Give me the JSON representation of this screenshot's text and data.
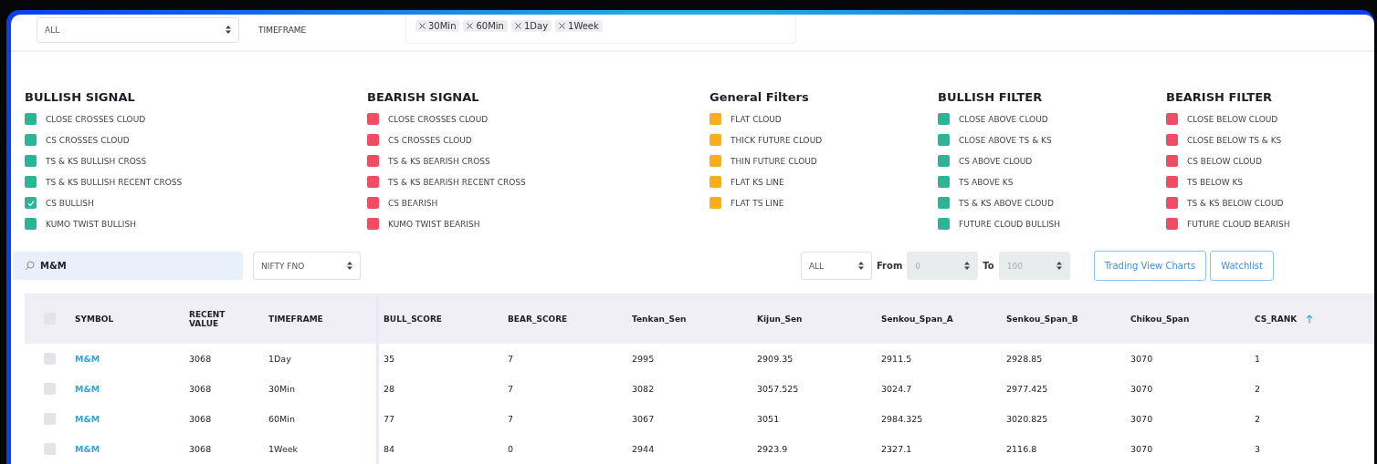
{
  "top_bar": {
    "market_select": {
      "value": "ALL"
    },
    "timeframe_label": "TIMEFRAME",
    "timeframe_tags": [
      "30Min",
      "60Min",
      "1Day",
      "1Week"
    ]
  },
  "filter_groups": [
    {
      "title": "BULLISH SIGNAL",
      "color": "#2bb597",
      "items": [
        {
          "label": "CLOSE CROSSES CLOUD",
          "checked": false
        },
        {
          "label": "CS CROSSES CLOUD",
          "checked": false
        },
        {
          "label": "TS & KS BULLISH CROSS",
          "checked": false
        },
        {
          "label": "TS & KS BULLISH RECENT CROSS",
          "checked": false
        },
        {
          "label": "CS BULLISH",
          "checked": true
        },
        {
          "label": "KUMO TWIST BULLISH",
          "checked": false
        }
      ]
    },
    {
      "title": "BEARISH SIGNAL",
      "color": "#ee4d64",
      "items": [
        {
          "label": "CLOSE CROSSES CLOUD",
          "checked": false
        },
        {
          "label": "CS CROSSES CLOUD",
          "checked": false
        },
        {
          "label": "TS & KS BEARISH CROSS",
          "checked": false
        },
        {
          "label": "TS & KS BEARISH RECENT CROSS",
          "checked": false
        },
        {
          "label": "CS BEARISH",
          "checked": false
        },
        {
          "label": "KUMO TWIST BEARISH",
          "checked": false
        }
      ]
    },
    {
      "title": "General Filters",
      "color": "#fbad1c",
      "items": [
        {
          "label": "FLAT CLOUD",
          "checked": false
        },
        {
          "label": "THICK FUTURE CLOUD",
          "checked": false
        },
        {
          "label": "THIN FUTURE CLOUD",
          "checked": false
        },
        {
          "label": "FLAT KS LINE",
          "checked": false
        },
        {
          "label": "FLAT TS LINE",
          "checked": false
        }
      ]
    },
    {
      "title": "BULLISH FILTER",
      "color": "#2bb597",
      "items": [
        {
          "label": "CLOSE ABOVE CLOUD",
          "checked": false
        },
        {
          "label": "CLOSE ABOVE TS & KS",
          "checked": false
        },
        {
          "label": "CS ABOVE CLOUD",
          "checked": false
        },
        {
          "label": "TS ABOVE KS",
          "checked": false
        },
        {
          "label": "TS & KS ABOVE CLOUD",
          "checked": false
        },
        {
          "label": "FUTURE CLOUD BULLISH",
          "checked": false
        }
      ]
    },
    {
      "title": "BEARISH FILTER",
      "color": "#ee4d64",
      "items": [
        {
          "label": "CLOSE BELOW CLOUD",
          "checked": false
        },
        {
          "label": "CLOSE BELOW TS & KS",
          "checked": false
        },
        {
          "label": "CS BELOW CLOUD",
          "checked": false
        },
        {
          "label": "TS BELOW KS",
          "checked": false
        },
        {
          "label": "TS & KS BELOW CLOUD",
          "checked": false
        },
        {
          "label": "FUTURE CLOUD BEARISH",
          "checked": false
        }
      ]
    }
  ],
  "controls": {
    "search": {
      "value": "M&M"
    },
    "index_select": {
      "value": "NIFTY FNO",
      "disabled": false
    },
    "rank_select": {
      "value": "ALL",
      "disabled": false
    },
    "from_label": "From",
    "from_select": {
      "value": "0",
      "disabled": true
    },
    "to_label": "To",
    "to_select": {
      "value": "100",
      "disabled": true
    },
    "buttons": [
      "Trading View Charts",
      "Watchlist"
    ]
  },
  "table": {
    "header_checked": false,
    "columns": [
      {
        "label": "SYMBOL",
        "sorted": false
      },
      {
        "label": "RECENT VALUE",
        "sorted": false
      },
      {
        "label": "TIMEFRAME",
        "sorted": false
      },
      {
        "label": "BULL_SCORE",
        "sorted": false
      },
      {
        "label": "BEAR_SCORE",
        "sorted": false
      },
      {
        "label": "Tenkan_Sen",
        "sorted": false
      },
      {
        "label": "Kijun_Sen",
        "sorted": false
      },
      {
        "label": "Senkou_Span_A",
        "sorted": false
      },
      {
        "label": "Senkou_Span_B",
        "sorted": false
      },
      {
        "label": "Chikou_Span",
        "sorted": false
      },
      {
        "label": "CS_RANK",
        "sorted": true
      }
    ],
    "rows": [
      {
        "checked": false,
        "cells": [
          "M&M",
          "3068",
          "1Day",
          "35",
          "7",
          "2995",
          "2909.35",
          "2911.5",
          "2928.85",
          "3070",
          "1"
        ]
      },
      {
        "checked": false,
        "cells": [
          "M&M",
          "3068",
          "30Min",
          "28",
          "7",
          "3082",
          "3057.525",
          "3024.7",
          "2977.425",
          "3070",
          "2"
        ]
      },
      {
        "checked": false,
        "cells": [
          "M&M",
          "3068",
          "60Min",
          "77",
          "7",
          "3067",
          "3051",
          "2984.325",
          "3020.825",
          "3070",
          "2"
        ]
      },
      {
        "checked": false,
        "cells": [
          "M&M",
          "3068",
          "1Week",
          "84",
          "0",
          "2944",
          "2923.9",
          "2327.1",
          "2116.8",
          "3070",
          "3"
        ]
      }
    ]
  }
}
